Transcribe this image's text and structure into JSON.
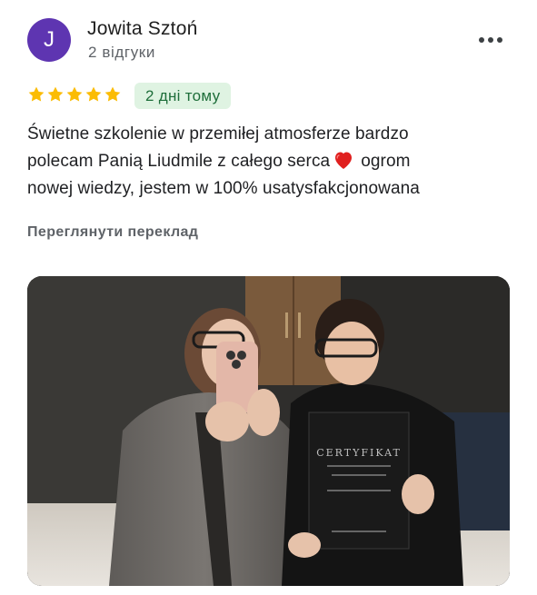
{
  "reviewer": {
    "initial": "J",
    "name": "Jowita Sztoń",
    "review_count": "2 відгуки",
    "avatar_color": "#5e35b1"
  },
  "rating": {
    "stars": 5,
    "max": 5,
    "star_color": "#fbbc04"
  },
  "date": "2 дні тому",
  "review_text_before_heart": "Świetne szkolenie w przemiłej atmosferze bardzo\npolecam Panią Liudmile z całego serca",
  "review_text_after_heart": "ogrom\nnowej wiedzy, jestem w 100% usatysfakcjonowana",
  "heart_icon": "red-heart-emoji",
  "translate_link": "Переглянути переклад",
  "menu_icon": "more-horizontal-icon",
  "photo": {
    "description_icon": "photo",
    "certificate_text": "CERTYFIKAT"
  }
}
